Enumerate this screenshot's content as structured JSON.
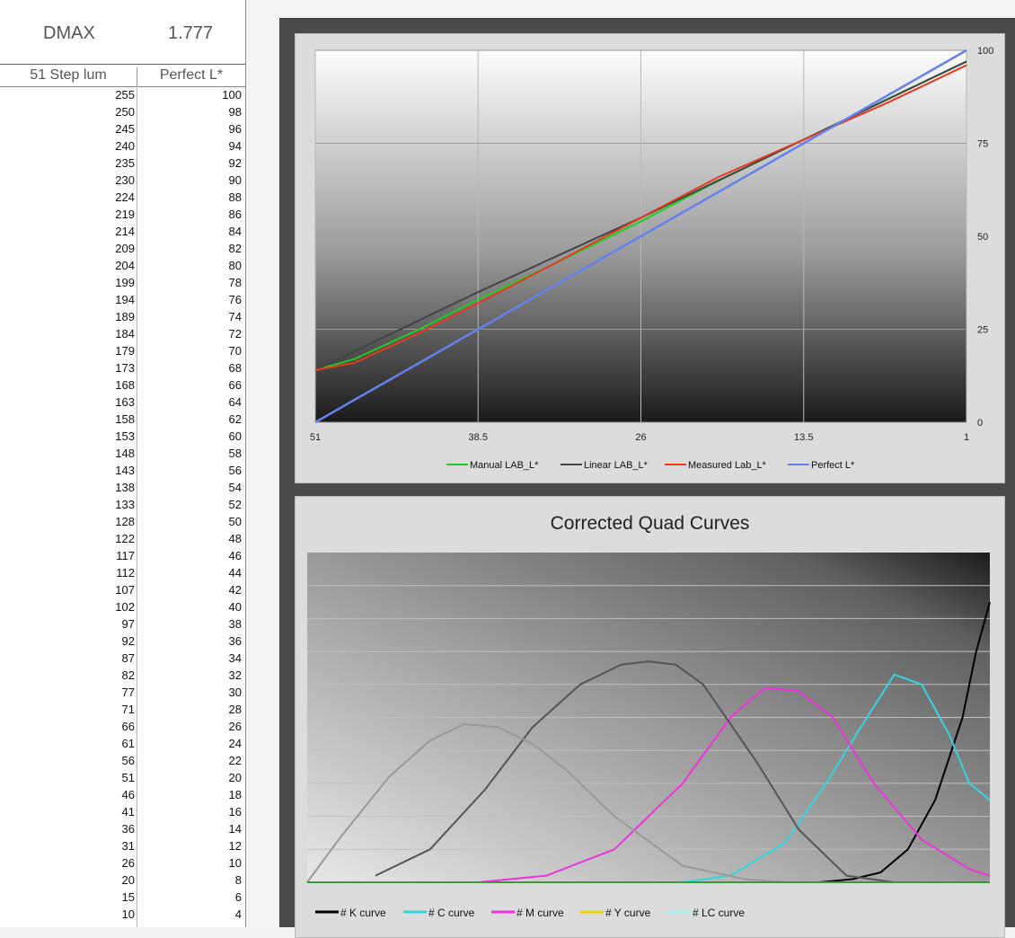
{
  "dmax": {
    "label": "DMAX",
    "value": "1.777"
  },
  "table": {
    "headers": [
      "51 Step lum",
      "Perfect L*"
    ],
    "rows": [
      [
        "255",
        "100"
      ],
      [
        "250",
        "98"
      ],
      [
        "245",
        "96"
      ],
      [
        "240",
        "94"
      ],
      [
        "235",
        "92"
      ],
      [
        "230",
        "90"
      ],
      [
        "224",
        "88"
      ],
      [
        "219",
        "86"
      ],
      [
        "214",
        "84"
      ],
      [
        "209",
        "82"
      ],
      [
        "204",
        "80"
      ],
      [
        "199",
        "78"
      ],
      [
        "194",
        "76"
      ],
      [
        "189",
        "74"
      ],
      [
        "184",
        "72"
      ],
      [
        "179",
        "70"
      ],
      [
        "173",
        "68"
      ],
      [
        "168",
        "66"
      ],
      [
        "163",
        "64"
      ],
      [
        "158",
        "62"
      ],
      [
        "153",
        "60"
      ],
      [
        "148",
        "58"
      ],
      [
        "143",
        "56"
      ],
      [
        "138",
        "54"
      ],
      [
        "133",
        "52"
      ],
      [
        "128",
        "50"
      ],
      [
        "122",
        "48"
      ],
      [
        "117",
        "46"
      ],
      [
        "112",
        "44"
      ],
      [
        "107",
        "42"
      ],
      [
        "102",
        "40"
      ],
      [
        "97",
        "38"
      ],
      [
        "92",
        "36"
      ],
      [
        "87",
        "34"
      ],
      [
        "82",
        "32"
      ],
      [
        "77",
        "30"
      ],
      [
        "71",
        "28"
      ],
      [
        "66",
        "26"
      ],
      [
        "61",
        "24"
      ],
      [
        "56",
        "22"
      ],
      [
        "51",
        "20"
      ],
      [
        "46",
        "18"
      ],
      [
        "41",
        "16"
      ],
      [
        "36",
        "14"
      ],
      [
        "31",
        "12"
      ],
      [
        "26",
        "10"
      ],
      [
        "20",
        "8"
      ],
      [
        "15",
        "6"
      ],
      [
        "10",
        "4"
      ]
    ]
  },
  "chart_data": [
    {
      "type": "line",
      "title": "",
      "x_ticks": [
        "51",
        "38.5",
        "26",
        "13.5",
        "1"
      ],
      "y_ticks": [
        "0",
        "25",
        "50",
        "75",
        "100"
      ],
      "xlim": [
        51,
        1
      ],
      "ylim": [
        0,
        100
      ],
      "grid": true,
      "legend_position": "bottom",
      "series": [
        {
          "name": "Manual  LAB_L*",
          "color": "#22cc22",
          "x": [
            51,
            48,
            43,
            38.5,
            33,
            26,
            20,
            13.5,
            7,
            1
          ],
          "y": [
            14,
            17,
            25,
            33,
            42,
            54,
            65,
            76,
            87,
            97
          ]
        },
        {
          "name": "Linear LAB_L*",
          "color": "#444444",
          "x": [
            51,
            38.5,
            26,
            13.5,
            1
          ],
          "y": [
            14,
            35,
            55,
            76,
            97
          ]
        },
        {
          "name": "Measured Lab_L*",
          "color": "#e53a1e",
          "x": [
            51,
            48,
            43,
            38.5,
            33,
            26,
            20,
            13.5,
            7,
            1
          ],
          "y": [
            14,
            16,
            24,
            32,
            42,
            55,
            66,
            76,
            86,
            96
          ]
        },
        {
          "name": "Perfect L*",
          "color": "#6680ee",
          "x": [
            51,
            38.5,
            26,
            13.5,
            1
          ],
          "y": [
            0,
            25,
            50,
            75,
            100
          ]
        }
      ]
    },
    {
      "type": "line",
      "title": "Corrected Quad Curves",
      "xlim": [
        0,
        100
      ],
      "ylim": [
        0,
        100
      ],
      "grid": true,
      "legend_position": "bottom",
      "series": [
        {
          "name": "# K curve",
          "color": "#000000",
          "x": [
            75,
            80,
            84,
            88,
            92,
            96,
            98,
            100
          ],
          "y": [
            0,
            1,
            3,
            10,
            25,
            50,
            70,
            85
          ]
        },
        {
          "name": "# C curve",
          "color": "#33d6dd",
          "x": [
            55,
            62,
            70,
            76,
            82,
            86,
            90,
            94,
            97,
            100
          ],
          "y": [
            0,
            2,
            12,
            30,
            50,
            63,
            60,
            45,
            30,
            25
          ]
        },
        {
          "name": "# M curve",
          "color": "#ee33dd",
          "x": [
            25,
            35,
            45,
            55,
            62,
            67,
            72,
            77,
            83,
            90,
            97,
            100
          ],
          "y": [
            0,
            2,
            10,
            30,
            50,
            59,
            58,
            50,
            30,
            13,
            4,
            2
          ]
        },
        {
          "name": "# Y curve",
          "color": "#e8d400",
          "x": [
            0,
            100
          ],
          "y": [
            0,
            0
          ]
        },
        {
          "name": "# LC curve",
          "color": "#aaf0f0",
          "x": [
            0,
            100
          ],
          "y": [
            0,
            0
          ]
        },
        {
          "name": "",
          "color": "#555555",
          "x": [
            10,
            18,
            26,
            33,
            40,
            46,
            50,
            54,
            58,
            62,
            66,
            72,
            79,
            86
          ],
          "y": [
            2,
            10,
            28,
            47,
            60,
            66,
            67,
            66,
            60,
            48,
            36,
            16,
            2,
            0
          ]
        },
        {
          "name": "",
          "color": "#999999",
          "x": [
            0,
            5,
            12,
            18,
            23,
            28,
            33,
            38,
            45,
            55,
            64,
            70
          ],
          "y": [
            0,
            14,
            32,
            43,
            48,
            47,
            42,
            34,
            20,
            5,
            1,
            0
          ]
        }
      ]
    }
  ]
}
